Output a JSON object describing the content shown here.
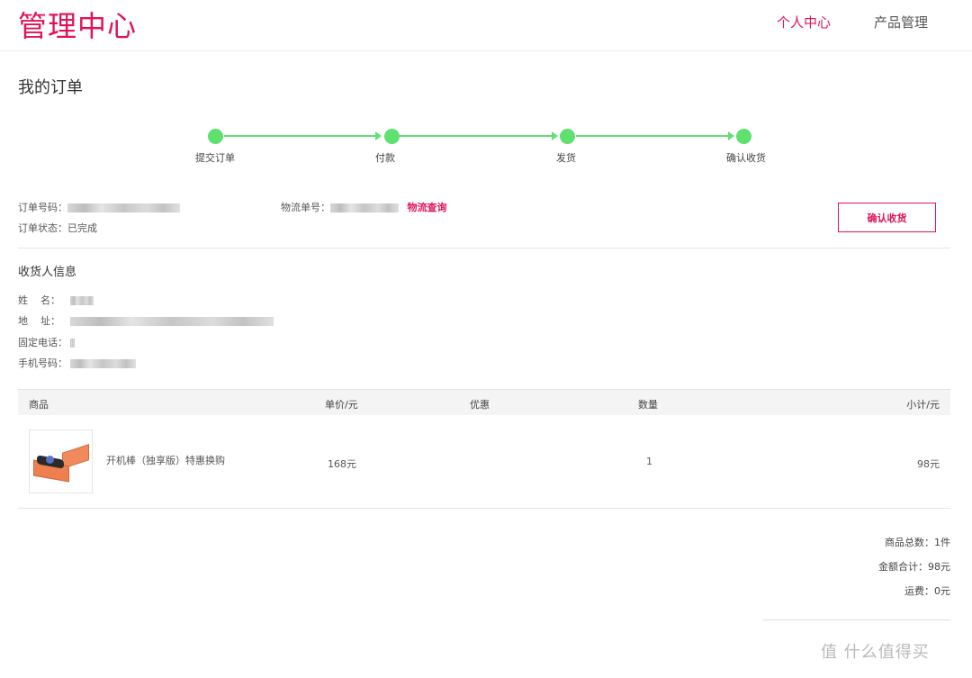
{
  "header": {
    "logo": "管理中心",
    "nav": [
      "个人中心",
      "产品管理"
    ]
  },
  "page_title": "我的订单",
  "steps": [
    "提交订单",
    "付款",
    "发货",
    "确认收货"
  ],
  "order": {
    "number_label": "订单号码：",
    "status_label": "订单状态：",
    "status_value": "已完成",
    "logistics_label": "物流单号：",
    "logistics_link": "物流查询",
    "confirm_button": "确认收货"
  },
  "recipient": {
    "title": "收货人信息",
    "name_label": "姓    名：",
    "address_label": "地    址：",
    "phone_label": "固定电话：",
    "mobile_label": "手机号码："
  },
  "table": {
    "headers": [
      "商品",
      "单价/元",
      "优惠",
      "数量",
      "小计/元"
    ],
    "rows": [
      {
        "name": "开机棒（独享版）特惠换购",
        "price": "168元",
        "discount": "",
        "qty": "1",
        "subtotal": "98元"
      }
    ]
  },
  "summary": {
    "total_items": "商品总数：1件",
    "total_amount": "金额合计：98元",
    "shipping": "运费：0元"
  },
  "watermark": "值 什么值得买",
  "colors": {
    "accent": "#e0125a",
    "progress": "#5fe06f"
  }
}
